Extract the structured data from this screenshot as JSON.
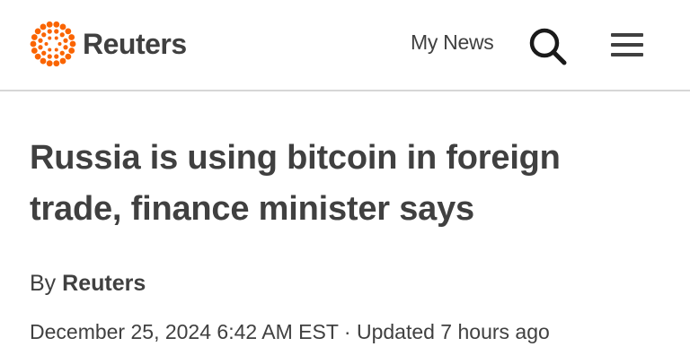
{
  "header": {
    "brand": "Reuters",
    "brand_color": "#fa6400",
    "my_news_label": "My News",
    "search_icon": "search-icon",
    "menu_icon": "hamburger-menu-icon"
  },
  "article": {
    "headline": "Russia is using bitcoin in foreign trade, finance minister says",
    "byline_prefix": "By",
    "author": "Reuters",
    "published": "December 25, 2024 6:42 AM EST",
    "separator": "·",
    "updated": "Updated 7 hours ago"
  }
}
